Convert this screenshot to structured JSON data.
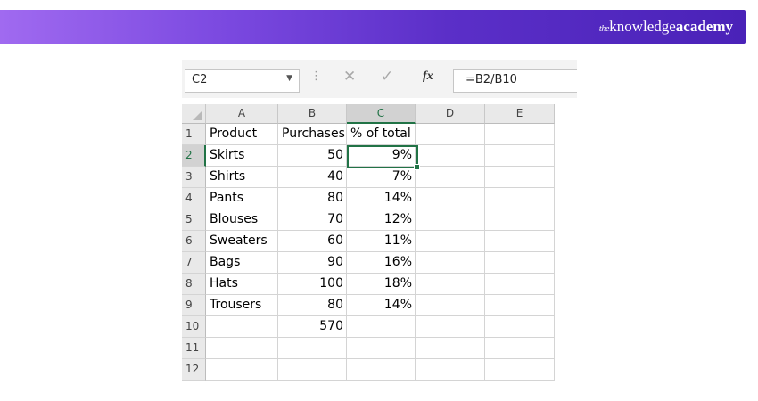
{
  "brand": {
    "the": "the",
    "knowledge": "knowledge",
    "academy": "academy"
  },
  "namebox": {
    "value": "C2"
  },
  "formula_bar": {
    "formula": "=B2/B10"
  },
  "icons": {
    "dropdown": "chevron-down-icon",
    "more": "vertical-dots-icon",
    "cancel": "cancel-x-icon",
    "enter": "checkmark-icon",
    "function": "fx-icon"
  },
  "columns": [
    "A",
    "B",
    "C",
    "D",
    "E"
  ],
  "selected_cell": "C2",
  "rows": [
    {
      "n": "1",
      "a": "Product",
      "b": "Purchases",
      "c": "% of total"
    },
    {
      "n": "2",
      "a": "Skirts",
      "b": "50",
      "c": "9%"
    },
    {
      "n": "3",
      "a": "Shirts",
      "b": "40",
      "c": "7%"
    },
    {
      "n": "4",
      "a": "Pants",
      "b": "80",
      "c": "14%"
    },
    {
      "n": "5",
      "a": "Blouses",
      "b": "70",
      "c": "12%"
    },
    {
      "n": "6",
      "a": "Sweaters",
      "b": "60",
      "c": "11%"
    },
    {
      "n": "7",
      "a": "Bags",
      "b": "90",
      "c": "16%"
    },
    {
      "n": "8",
      "a": "Hats",
      "b": "100",
      "c": "18%"
    },
    {
      "n": "9",
      "a": "Trousers",
      "b": "80",
      "c": "14%"
    },
    {
      "n": "10",
      "a": "",
      "b": "570",
      "c": ""
    },
    {
      "n": "11",
      "a": "",
      "b": "",
      "c": ""
    },
    {
      "n": "12",
      "a": "",
      "b": "",
      "c": ""
    }
  ],
  "colors": {
    "banner_start": "#a06af0",
    "banner_end": "#4a22b8",
    "excel_green": "#217346"
  }
}
